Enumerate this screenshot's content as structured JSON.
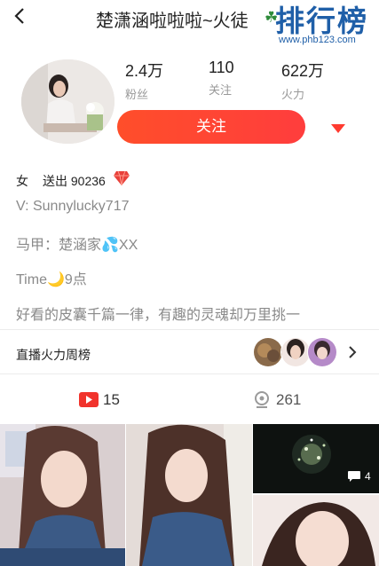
{
  "header": {
    "title": "楚潇涵啦啦啦~火徒",
    "back_icon": "chevron-left-icon",
    "emoji_icon": "clover-icon"
  },
  "watermark": {
    "brand": "排行榜",
    "url": "www.phb123.com"
  },
  "stats": [
    {
      "value": "2.4万",
      "label": "粉丝"
    },
    {
      "value": "110",
      "label": "关注"
    },
    {
      "value": "622万",
      "label": "火力"
    }
  ],
  "follow_button": {
    "label": "关注",
    "color": "#ff4231"
  },
  "profile": {
    "gender": "女",
    "sent_label": "送出 90236",
    "sent_icon": "gem-icon",
    "bio_lines": [
      "V: Sunnylucky717",
      "马甲：楚涵家💦XX",
      "Time🌙9点",
      "好看的皮囊千篇一律，有趣的灵魂却万里挑一"
    ]
  },
  "ranking": {
    "label": "直播火力周榜"
  },
  "tabs": {
    "videos_count": "15",
    "location_count": "261"
  },
  "grid": {
    "comment_count": "4"
  },
  "colors": {
    "accent": "#ff4231",
    "watermark_blue": "#1f5fa8",
    "muted_text": "#999999"
  }
}
